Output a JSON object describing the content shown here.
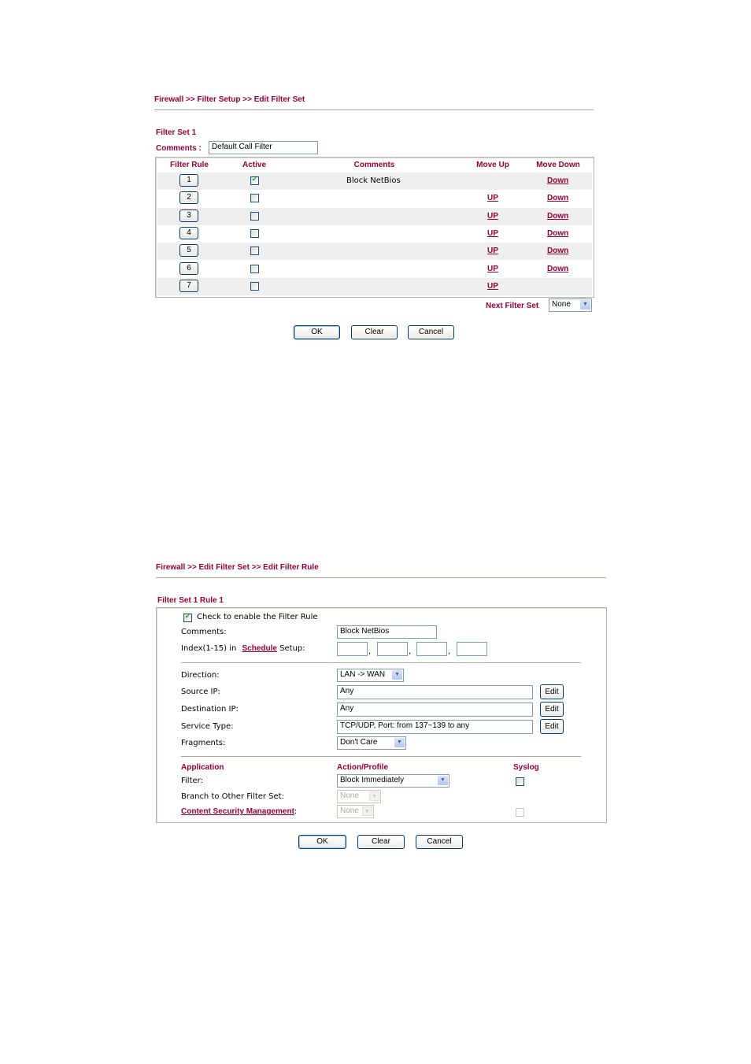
{
  "screen1": {
    "breadcrumb": "Firewall >> Filter Setup >> Edit Filter Set",
    "title": "Filter Set 1",
    "comments_label": "Comments :",
    "comments_value": "Default Call Filter",
    "columns": [
      "Filter Rule",
      "Active",
      "Comments",
      "Move Up",
      "Move Down"
    ],
    "rules": [
      {
        "num": "1",
        "active": true,
        "comment": "Block NetBios",
        "up": "",
        "down": "Down"
      },
      {
        "num": "2",
        "active": false,
        "comment": "",
        "up": "UP",
        "down": "Down"
      },
      {
        "num": "3",
        "active": false,
        "comment": "",
        "up": "UP",
        "down": "Down"
      },
      {
        "num": "4",
        "active": false,
        "comment": "",
        "up": "UP",
        "down": "Down"
      },
      {
        "num": "5",
        "active": false,
        "comment": "",
        "up": "UP",
        "down": "Down"
      },
      {
        "num": "6",
        "active": false,
        "comment": "",
        "up": "UP",
        "down": "Down"
      },
      {
        "num": "7",
        "active": false,
        "comment": "",
        "up": "UP",
        "down": ""
      }
    ],
    "next_filter_set_label": "Next Filter Set",
    "next_filter_set_value": "None",
    "buttons": {
      "ok": "OK",
      "clear": "Clear",
      "cancel": "Cancel"
    }
  },
  "screen2": {
    "breadcrumb": "Firewall >> Edit Filter Set >> Edit Filter Rule",
    "title": "Filter Set 1 Rule 1",
    "enable_label": "Check to enable the Filter Rule",
    "enable_checked": true,
    "comments_label": "Comments:",
    "comments_value": "Block NetBios",
    "index_label_pre": "Index(1-15) in",
    "index_link": "Schedule",
    "index_label_post": "Setup:",
    "index_values": [
      "",
      "",
      "",
      ""
    ],
    "direction_label": "Direction:",
    "direction_value": "LAN -> WAN",
    "source_ip_label": "Source IP:",
    "source_ip_value": "Any",
    "dest_ip_label": "Destination IP:",
    "dest_ip_value": "Any",
    "service_type_label": "Service Type:",
    "service_type_value": "TCP/UDP, Port: from 137~139 to any",
    "fragments_label": "Fragments:",
    "fragments_value": "Don't Care",
    "edit_label": "Edit",
    "app_header": "Application",
    "action_header": "Action/Profile",
    "syslog_header": "Syslog",
    "filter_label": "Filter:",
    "filter_value": "Block Immediately",
    "filter_syslog": false,
    "branch_label": "Branch to Other Filter Set:",
    "branch_value": "None",
    "csm_label": "Content Security Management",
    "csm_colon": ":",
    "csm_value": "None",
    "buttons": {
      "ok": "OK",
      "clear": "Clear",
      "cancel": "Cancel"
    }
  }
}
